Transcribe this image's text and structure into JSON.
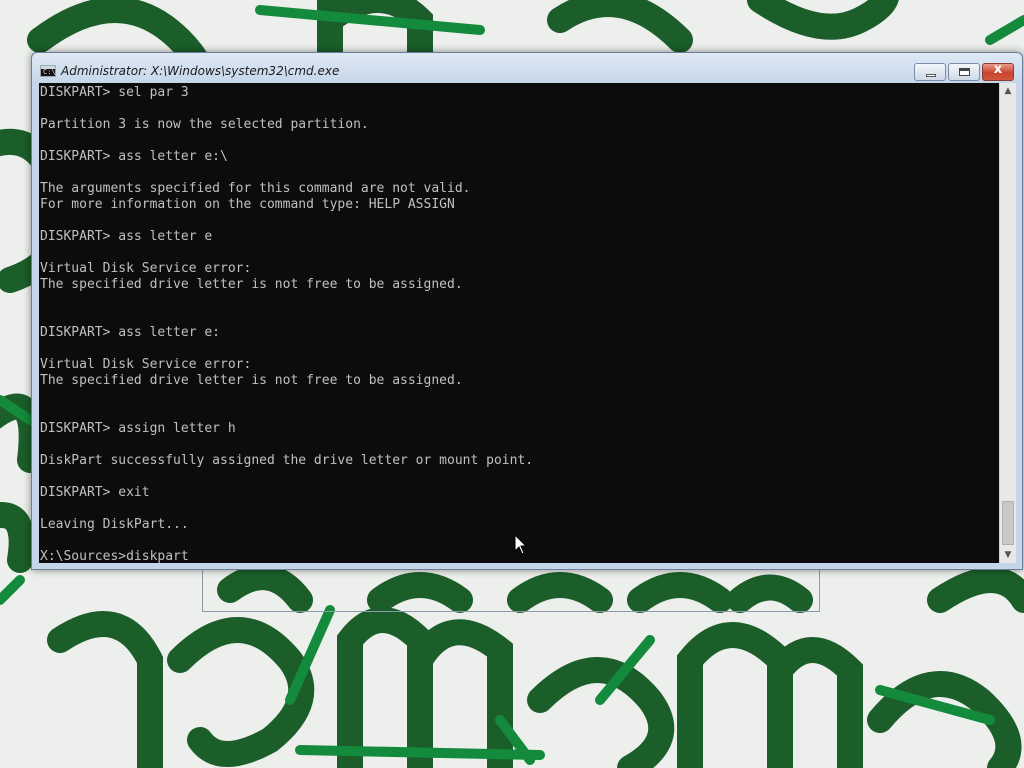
{
  "window": {
    "title": "Administrator: X:\\Windows\\system32\\cmd.exe",
    "icon": "cmd-app-icon",
    "controls": {
      "minimize_icon": "minimize-icon",
      "maximize_icon": "maximize-icon",
      "close_icon": "close-icon",
      "close_glyph": "x"
    }
  },
  "console": {
    "lines": [
      "DISKPART> sel par 3",
      "",
      "Partition 3 is now the selected partition.",
      "",
      "DISKPART> ass letter e:\\",
      "",
      "The arguments specified for this command are not valid.",
      "For more information on the command type: HELP ASSIGN",
      "",
      "DISKPART> ass letter e",
      "",
      "Virtual Disk Service error:",
      "The specified drive letter is not free to be assigned.",
      "",
      "",
      "DISKPART> ass letter e:",
      "",
      "Virtual Disk Service error:",
      "The specified drive letter is not free to be assigned.",
      "",
      "",
      "DISKPART> assign letter h",
      "",
      "DiskPart successfully assigned the drive letter or mount point.",
      "",
      "DISKPART> exit",
      "",
      "Leaving DiskPart...",
      "",
      "X:\\Sources>diskpart"
    ],
    "text_color": "#c0c0c0",
    "background_color": "#0c0c0c"
  },
  "scrollbar": {
    "up_icon": "scroll-up-arrow-icon",
    "down_icon": "scroll-down-arrow-icon"
  },
  "desktop": {
    "wallpaper_colors": [
      "#ecefec",
      "#1b5e2a",
      "#138a3c"
    ]
  }
}
